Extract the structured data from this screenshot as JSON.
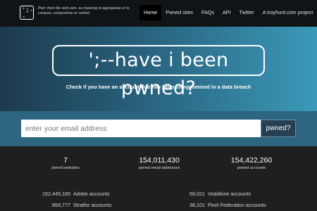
{
  "navbar": {
    "logo_glyph": "';--",
    "tagline": "Pwn: from the verb own, as meaning to appropriate or to conquer, compromise or control.",
    "items": [
      {
        "label": "Home",
        "active": true
      },
      {
        "label": "Pwned sites",
        "active": false
      },
      {
        "label": "FAQs",
        "active": false
      },
      {
        "label": "API",
        "active": false
      },
      {
        "label": "Twitter",
        "active": false
      },
      {
        "label": "A troyhunt.com project",
        "active": false
      }
    ]
  },
  "hero": {
    "title": "';--have i been pwned?",
    "subtitle": "Check if you have an account that has been compromised in a data breach"
  },
  "search": {
    "placeholder": "enter your email address",
    "button_label": "pwned?"
  },
  "stats": [
    {
      "value": "7",
      "label": "pwned websites"
    },
    {
      "value": "154,011,430",
      "label": "pwned email addresses"
    },
    {
      "value": "154,422,260",
      "label": "pwned accounts"
    }
  ],
  "breaches_left": [
    {
      "count": "152,445,165",
      "name": "Adobe accounts"
    },
    {
      "count": "859,777",
      "name": "Stratfor accounts"
    }
  ],
  "breaches_right": [
    {
      "count": "56,021",
      "name": "Vodafone accounts"
    },
    {
      "count": "38,101",
      "name": "Pixel Federation accounts"
    }
  ],
  "colors": {
    "navbar_bg": "#111417",
    "hero_gradient_left": "#1d3a4c",
    "hero_gradient_right": "#3b9ab9",
    "search_strip": "#2c657f",
    "button_bg": "#273f52",
    "stats_bg": "#1f1f1f"
  }
}
